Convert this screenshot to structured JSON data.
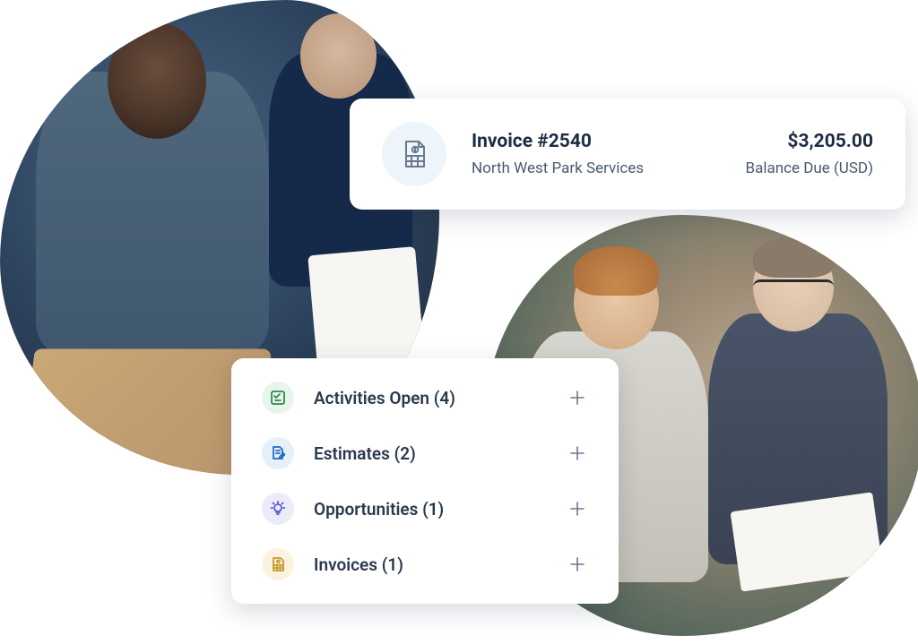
{
  "invoice": {
    "title": "Invoice #2540",
    "customer": "North West Park Services",
    "amount": "$3,205.00",
    "balance_label": "Balance Due (USD)"
  },
  "sidebar": {
    "items": [
      {
        "label": "Activities Open (4)",
        "icon": "checklist-icon",
        "color": "#2e8a4e"
      },
      {
        "label": "Estimates (2)",
        "icon": "document-edit-icon",
        "color": "#1e6ac8"
      },
      {
        "label": "Opportunities (1)",
        "icon": "lightbulb-icon",
        "color": "#5a5ad8"
      },
      {
        "label": "Invoices (1)",
        "icon": "invoice-icon",
        "color": "#c89a2e"
      }
    ]
  }
}
